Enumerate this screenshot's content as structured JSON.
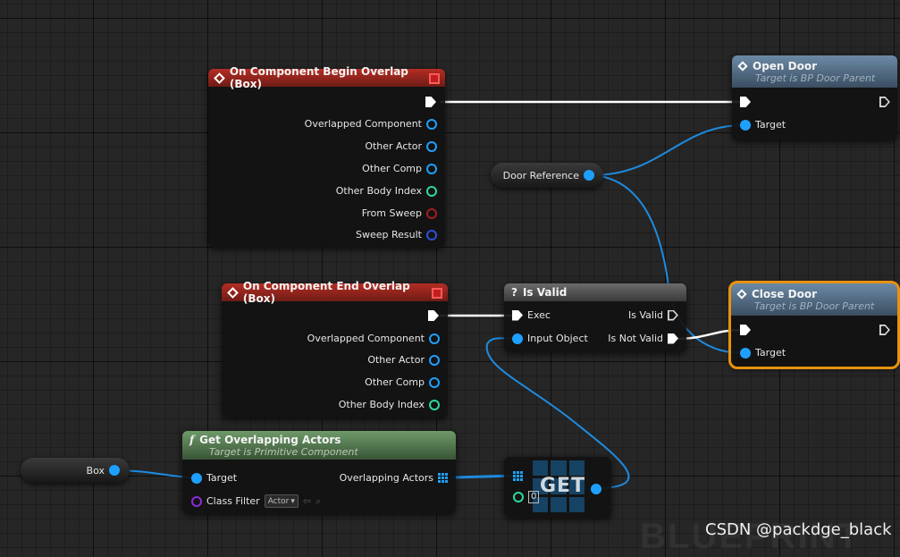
{
  "nodes": {
    "begin_overlap": {
      "title": "On Component Begin Overlap (Box)",
      "pins": [
        "Overlapped Component",
        "Other Actor",
        "Other Comp",
        "Other Body Index",
        "From Sweep",
        "Sweep Result"
      ]
    },
    "end_overlap": {
      "title": "On Component End Overlap (Box)",
      "pins": [
        "Overlapped Component",
        "Other Actor",
        "Other Comp",
        "Other Body Index"
      ]
    },
    "open_door": {
      "title": "Open Door",
      "subtitle": "Target is BP Door Parent",
      "target": "Target"
    },
    "close_door": {
      "title": "Close Door",
      "subtitle": "Target is BP Door Parent",
      "target": "Target"
    },
    "door_reference": {
      "label": "Door Reference"
    },
    "is_valid": {
      "title": "Is Valid",
      "exec": "Exec",
      "input_object": "Input Object",
      "is_valid_out": "Is Valid",
      "is_not_valid_out": "Is Not Valid"
    },
    "box": {
      "label": "Box"
    },
    "get_overlapping": {
      "title": "Get Overlapping Actors",
      "subtitle": "Target is Primitive Component",
      "target": "Target",
      "class_filter": "Class Filter",
      "class_value": "Actor",
      "output": "Overlapping Actors"
    },
    "get": {
      "label": "GET",
      "index": "0"
    }
  },
  "watermark": "CSDN @packdge_black",
  "background_text": "BLUEPRINT",
  "colors": {
    "event_header": "#b42d23",
    "function_header": "#4d6a85",
    "pure_header": "#5c7f57",
    "object_pin": "#1ea0ff",
    "selection": "#e8920e"
  }
}
